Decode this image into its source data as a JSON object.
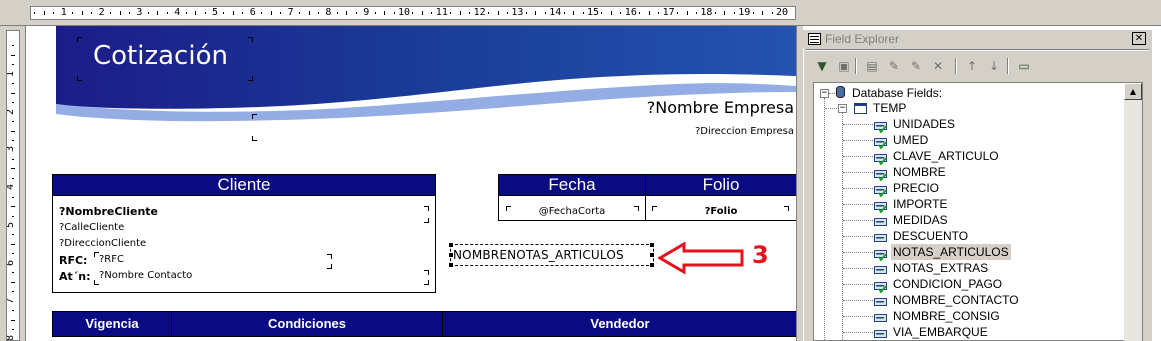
{
  "ruler": {
    "h_labels": [
      "1",
      "2",
      "3",
      "4",
      "5",
      "6",
      "7",
      "8",
      "9",
      "10",
      "11",
      "12",
      "13",
      "14",
      "15",
      "16",
      "17",
      "18",
      "19",
      "20"
    ],
    "v_labels": [
      "1",
      "2",
      "3",
      "4",
      "5",
      "6",
      "7",
      "8"
    ]
  },
  "report": {
    "title": "Cotización",
    "company_name": "?Nombre Empresa",
    "company_address": "?Direccion Empresa",
    "client_header": "Cliente",
    "client_name": "?NombreCliente",
    "client_street": "?CalleCliente",
    "client_address": "?DireccionCliente",
    "rfc_label": "RFC:",
    "rfc_value": "?RFC",
    "attn_label": "At´n:",
    "contact_value": "?Nombre Contacto",
    "date_header": "Fecha",
    "date_value": "@FechaCorta",
    "folio_header": "Folio",
    "folio_value": "?Folio",
    "dragged_field_text": "NOMBRENOTAS_ARTICULOS",
    "annotation_number": "3",
    "footer_headers": [
      "Vigencia",
      "Condiciones",
      "Vendedor"
    ],
    "colors": {
      "navy": "#0a0a82",
      "arrow": "#e8101a"
    }
  },
  "field_explorer": {
    "title": "Field Explorer",
    "close_glyph": "✕",
    "root_label": "Database Fields:",
    "table_label": "TEMP",
    "fields": [
      "UNIDADES",
      "UMED",
      "CLAVE_ARTICULO",
      "NOMBRE",
      "PRECIO",
      "IMPORTE",
      "MEDIDAS",
      "DESCUENTO",
      "NOTAS_ARTICULOS",
      "NOTAS_EXTRAS",
      "CONDICION_PAGO",
      "NOMBRE_CONTACTO",
      "NOMBRE_CONSIG",
      "VIA_EMBARQUE"
    ],
    "used_fields": [
      "UNIDADES",
      "UMED",
      "CLAVE_ARTICULO",
      "NOMBRE",
      "PRECIO",
      "IMPORTE",
      "NOTAS_ARTICULOS",
      "CONDICION_PAGO"
    ],
    "selected_field": "NOTAS_ARTICULOS",
    "expander_root": "−",
    "expander_table": "−",
    "toolbar_icons": [
      "insert-field-icon",
      "browse-field-icon",
      "new-formula-icon",
      "edit-icon",
      "rename-icon",
      "delete-icon",
      "move-up-icon",
      "move-down-icon",
      "properties-icon"
    ],
    "scroll_up_glyph": "▲"
  }
}
